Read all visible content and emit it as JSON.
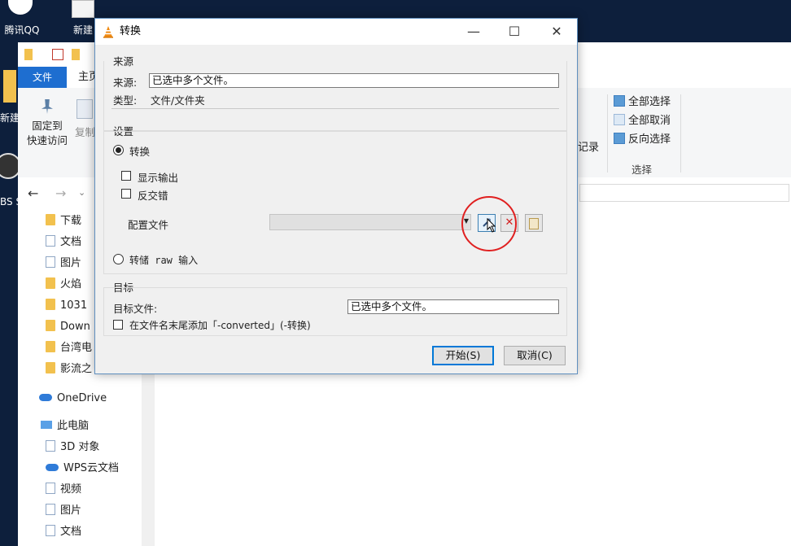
{
  "desktop": {
    "icons": [
      {
        "label": "腾讯QQ"
      },
      {
        "label": "新建"
      },
      {
        "label": "新建文"
      },
      {
        "label": "BS S"
      }
    ]
  },
  "explorer": {
    "tabs": {
      "file": "文件",
      "home": "主页"
    },
    "ribbon": {
      "pin_label": "固定到\n快速访问",
      "copy_label": "复制",
      "history_label": "记录",
      "select_all": "全部选择",
      "select_none": "全部取消",
      "invert_select": "反向选择",
      "group_select": "选择"
    },
    "nav_items": [
      {
        "label": "下载",
        "icon": "download-folder-icon"
      },
      {
        "label": "文档",
        "icon": "document-icon"
      },
      {
        "label": "图片",
        "icon": "picture-icon"
      },
      {
        "label": "火焰",
        "icon": "folder-icon"
      },
      {
        "label": "1031",
        "icon": "folder-icon"
      },
      {
        "label": "Down",
        "icon": "folder-icon"
      },
      {
        "label": "台湾电",
        "icon": "folder-icon"
      },
      {
        "label": "影流之",
        "icon": "folder-icon"
      },
      {
        "label": "OneDrive",
        "icon": "cloud-icon"
      },
      {
        "label": "此电脑",
        "icon": "computer-icon"
      },
      {
        "label": "3D 对象",
        "icon": "cube-icon"
      },
      {
        "label": "WPS云文档",
        "icon": "cloud-icon"
      },
      {
        "label": "视频",
        "icon": "video-icon"
      },
      {
        "label": "图片",
        "icon": "picture-icon"
      },
      {
        "label": "文档",
        "icon": "document-icon"
      }
    ]
  },
  "dialog": {
    "title": "转换",
    "source": {
      "group_label": "来源",
      "source_label": "来源:",
      "source_value": "已选中多个文件。",
      "type_label": "类型:",
      "type_value": "文件/文件夹"
    },
    "settings": {
      "group_label": "设置",
      "convert_label": "转换",
      "convert_selected": true,
      "show_output_label": "显示输出",
      "show_output_checked": false,
      "deinterlace_label": "反交错",
      "deinterlace_checked": false,
      "profile_label": "配置文件",
      "profile_value": "",
      "dump_raw_label": "转储 raw 输入",
      "dump_raw_selected": false
    },
    "target": {
      "group_label": "目标",
      "target_file_label": "目标文件:",
      "target_file_value": "已选中多个文件。",
      "append_label": "在文件名末尾添加「-converted」(-转换)",
      "append_checked": false
    },
    "buttons": {
      "start": "开始(S)",
      "cancel": "取消(C)"
    }
  },
  "colors": {
    "accent": "#1e6ed0",
    "annotation": "#e02020",
    "delete_red": "#d32020"
  }
}
